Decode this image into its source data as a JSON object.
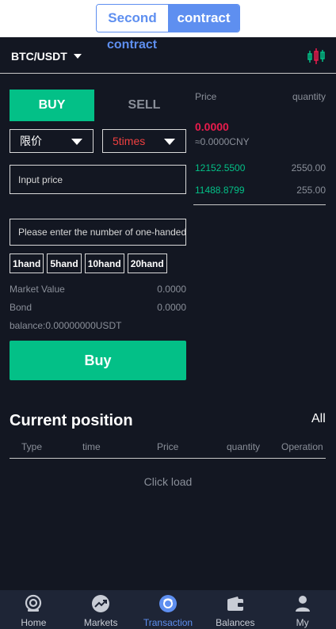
{
  "switcher": {
    "second": "Second",
    "contract": "contract"
  },
  "mode_label": "contract",
  "pair": "BTC/USDT",
  "trade": {
    "buy_tab": "BUY",
    "sell_tab": "SELL",
    "order_type": "限价",
    "leverage": "5times",
    "price_placeholder": "Input price",
    "qty_placeholder": "Please enter the number of one-handed",
    "hands": [
      "1hand",
      "5hand",
      "10hand",
      "20hand"
    ],
    "market_value_label": "Market Value",
    "market_value": "0.0000",
    "bond_label": "Bond",
    "bond": "0.0000",
    "balance": "balance:0.00000000USDT",
    "submit": "Buy"
  },
  "orderbook": {
    "price_header": "Price",
    "quantity_header": "quantity",
    "last_price": "0.0000",
    "cny": "≈0.0000CNY",
    "rows": [
      {
        "price": "12152.5500",
        "quantity": "2550.00"
      },
      {
        "price": "11488.8799",
        "quantity": "255.00"
      }
    ]
  },
  "position": {
    "title": "Current position",
    "all": "All",
    "columns": [
      "Type",
      "time",
      "Price",
      "quantity",
      "Operation"
    ],
    "empty": "Click load"
  },
  "tabbar": [
    {
      "label": "Home",
      "icon": "home-icon"
    },
    {
      "label": "Markets",
      "icon": "markets-icon"
    },
    {
      "label": "Transaction",
      "icon": "transaction-icon",
      "active": true
    },
    {
      "label": "Balances",
      "icon": "wallet-icon"
    },
    {
      "label": "My",
      "icon": "user-icon"
    }
  ],
  "colors": {
    "background": "#131722",
    "accent_blue": "#5e8ff0",
    "buy_green": "#03c087",
    "sell_red": "#ea1c4d"
  }
}
